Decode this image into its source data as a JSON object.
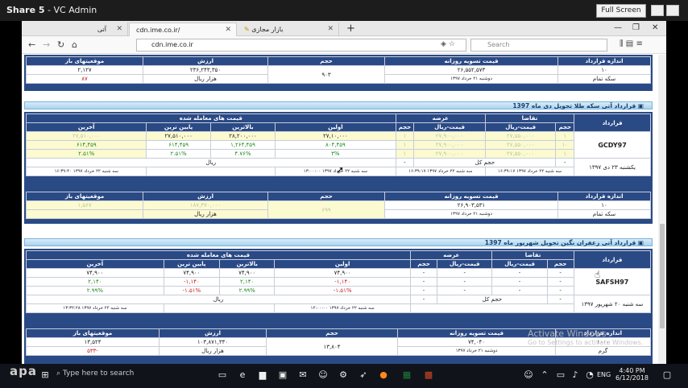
{
  "share": {
    "title_bold": "Share 5",
    "title_rest": " - VC Admin",
    "fullscreen_label": "Full Screen"
  },
  "browser": {
    "tabs": [
      {
        "label": "آتی"
      },
      {
        "label": "cdn.ime.co.ir/"
      },
      {
        "label": "بازار مجازی"
      }
    ],
    "url": "cdn.ime.co.ir",
    "search_placeholder": "Search"
  },
  "headers": {
    "size": "اندازه قرارداد",
    "settle_price": "قیمت تسویه روزانه",
    "volume": "حجم",
    "value": "ارزش",
    "open_positions": "موقعیتهای باز",
    "contract": "قرارداد",
    "demand": "تقاضا",
    "supply": "عرضه",
    "traded_prices": "قیمت های معامله شده",
    "qty": "حجم",
    "price_rial": "قیمت-ریال",
    "first": "اولین",
    "highest": "بالاترین",
    "lowest": "پایین ترین",
    "last": "آخرین",
    "total_volume": "حجم کل",
    "rial": "ریال",
    "thousand_rial": "هزار ریال",
    "gram": "گرم",
    "full_coin": "سکه تمام"
  },
  "block1": {
    "size": "۱۰",
    "settle": "۲۶,۵۵۲,۵۷۳",
    "settle_date": "دوشنبه ۲۱ خرداد ۱۳۹۷",
    "volume": "۹۰۳",
    "value": "۲۳۶,۲۴۳,۳۵۰",
    "open": "۲,۱۲۷",
    "open_change": "۸۷"
  },
  "block2": {
    "title": "قرارداد آتی سکه طلا تحویل دی ماه 1397",
    "code": "GCDY97",
    "expiry": "یکشنبه ۲۳ دی ۱۳۹۷",
    "first": "۲۷,۱۰,۰۰۰",
    "highest": "۲۸,۲۰۰,۰۰۰",
    "lowest": "۲۷,۵۱۰,۰۰۰",
    "last": "۲۷,۵۱۰,۰۰۰",
    "first_chg": "۸۰۴,۴۵۹",
    "highest_chg": "۱,۲۶۴,۴۵۹",
    "lowest_chg": "۶۱۴,۴۵۹",
    "first_pct": "۳%",
    "highest_pct": "۴.۷۶%",
    "lowest_pct": "۲.۵۱%",
    "first_time": "۱۳:۰۰:۰۰ سه شنبه ۲۲ خرداد ۱۳۹۷",
    "last_time": "۱۶:۳۹:۴۰ سه شنبه ۲۲ خرداد ۱۳۹۷",
    "order_time": "سه شنبه ۲۲ خرداد ۱۳۹۷ ۱۶:۳۹:۱۷",
    "demand_qty": "۱",
    "demand_price": "۲۷,۵۵۰,۰۰۰",
    "supply_price": "۲۷,۹۰۰,۰۰۰",
    "supply_qty": "۱",
    "contract_size": "۱۰",
    "dash": "-",
    "size": "۱۰",
    "settle": "۲۶,۹۰۳,۵۳۱",
    "settle_date": "دوشنبه ۲۱ خرداد ۱۳۹۷",
    "volume": "۶۹۹",
    "value": "۱۸۷,۳۷۰,۰۰۰",
    "open": "۱,۵۶۷"
  },
  "block3": {
    "title": "قرارداد آتی زعفران نگین تحویل شهریور ماه 1397",
    "code": "SAFSH97",
    "expiry": "سه شنبه ۲۰ شهریور ۱۳۹۷",
    "first": "۷۴,۹۰۰",
    "highest": "۷۴,۹۰۰",
    "lowest": "۷۴,۹۰۰",
    "last": "۷۴,۹۰۰",
    "first_chg": "-۱,۱۴۰",
    "highest_chg": "۲,۱۴۰",
    "lowest_chg": "-۱,۱۴۰",
    "last_chg": "۲,۱۴۰",
    "first_pct": "-۱.۵۱%",
    "highest_pct": "۲.۹۹%",
    "lowest_pct": "-۱.۵۱%",
    "last_pct": "۲.۹۹%",
    "first_time": "۱۲:۰۰:۰۰ سه شنبه ۲۲ خرداد ۱۳۹۷",
    "last_time": "۱۳:۳۲:۲۸ سه شنبه ۲۲ خرداد ۱۳۹۷",
    "dash": "-",
    "size": "۱۰۰۰",
    "settle": "۷۴,۰۴۰",
    "settle_date": "دوشنبه ۲۱ خرداد ۱۳۹۷",
    "volume": "۱۳,۸۰۴",
    "value": "۱۰۳,۸۷۱,۳۳۰",
    "open": "۱۳,۵۲۴",
    "open_change": "۵۳۳-"
  },
  "windows": {
    "activate_title": "Activate Windows",
    "activate_sub": "Go to Settings to activate Windows."
  },
  "taskbar": {
    "search": "Type here to search",
    "lang": "ENG",
    "time": "4:40 PM",
    "date": "6/12/2018",
    "watermark": "apa"
  }
}
